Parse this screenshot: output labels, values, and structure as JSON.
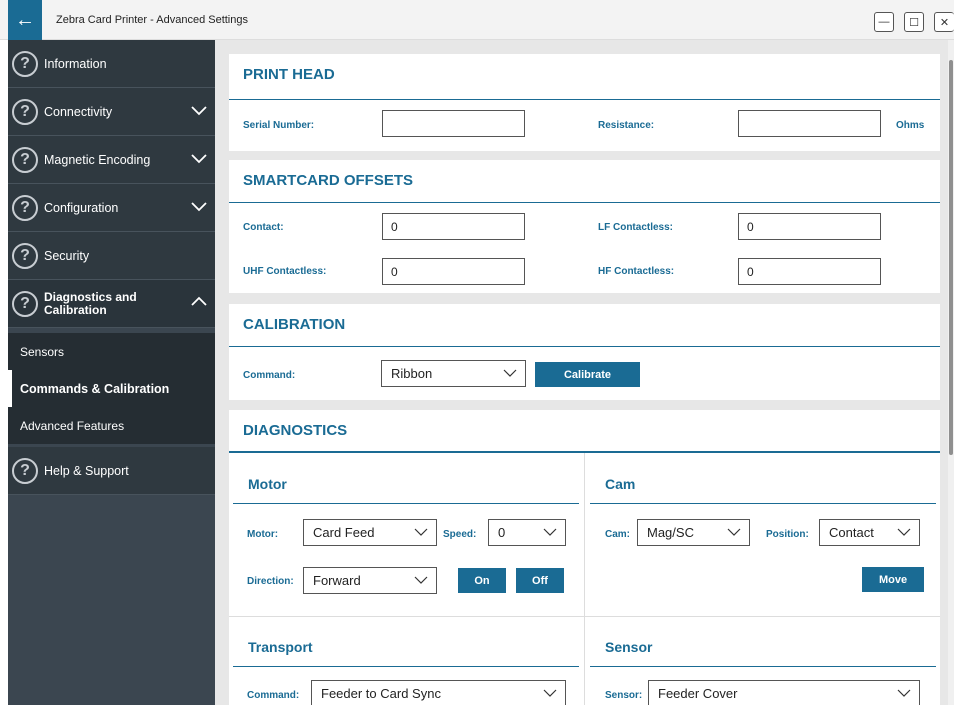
{
  "window": {
    "title": "Zebra Card Printer - Advanced Settings",
    "minimize_glyph": "—",
    "maximize_glyph": "☐",
    "close_glyph": "✕",
    "back_glyph": "←"
  },
  "sidebar": {
    "items": [
      {
        "label": "Information"
      },
      {
        "label": "Connectivity"
      },
      {
        "label": "Magnetic Encoding"
      },
      {
        "label": "Configuration"
      },
      {
        "label": "Security"
      },
      {
        "label_line1": "Diagnostics and",
        "label_line2": "Calibration"
      },
      {
        "label": "Help & Support"
      }
    ],
    "sub_items": [
      {
        "label": "Sensors"
      },
      {
        "label": "Commands & Calibration"
      },
      {
        "label": "Advanced Features"
      }
    ],
    "help_glyph": "?"
  },
  "print_head": {
    "title": "PRINT HEAD",
    "serial_label": "Serial Number:",
    "serial_value": "",
    "resistance_label": "Resistance:",
    "resistance_value": "",
    "resistance_unit": "Ohms"
  },
  "smartcard": {
    "title": "SMARTCARD OFFSETS",
    "contact_label": "Contact:",
    "contact_value": "0",
    "lf_label": "LF Contactless:",
    "lf_value": "0",
    "uhf_label": "UHF Contactless:",
    "uhf_value": "0",
    "hf_label": "HF Contactless:",
    "hf_value": "0"
  },
  "calibration": {
    "title": "CALIBRATION",
    "command_label": "Command:",
    "command_value": "Ribbon",
    "calibrate_label": "Calibrate"
  },
  "diagnostics": {
    "title": "DIAGNOSTICS",
    "motor": {
      "title": "Motor",
      "motor_label": "Motor:",
      "motor_value": "Card Feed",
      "speed_label": "Speed:",
      "speed_value": "0",
      "direction_label": "Direction:",
      "direction_value": "Forward",
      "on_label": "On",
      "off_label": "Off"
    },
    "cam": {
      "title": "Cam",
      "cam_label": "Cam:",
      "cam_value": "Mag/SC",
      "position_label": "Position:",
      "position_value": "Contact",
      "move_label": "Move"
    },
    "transport": {
      "title": "Transport",
      "command_label": "Command:",
      "command_value": "Feeder to Card Sync"
    },
    "sensor": {
      "title": "Sensor",
      "sensor_label": "Sensor:",
      "sensor_value": "Feeder Cover"
    }
  },
  "colors": {
    "accent": "#1a6b94",
    "sidebar_bg": "#2f3940",
    "sidebar_sub_bg": "#252d33",
    "main_bg": "#e7e7e7"
  }
}
